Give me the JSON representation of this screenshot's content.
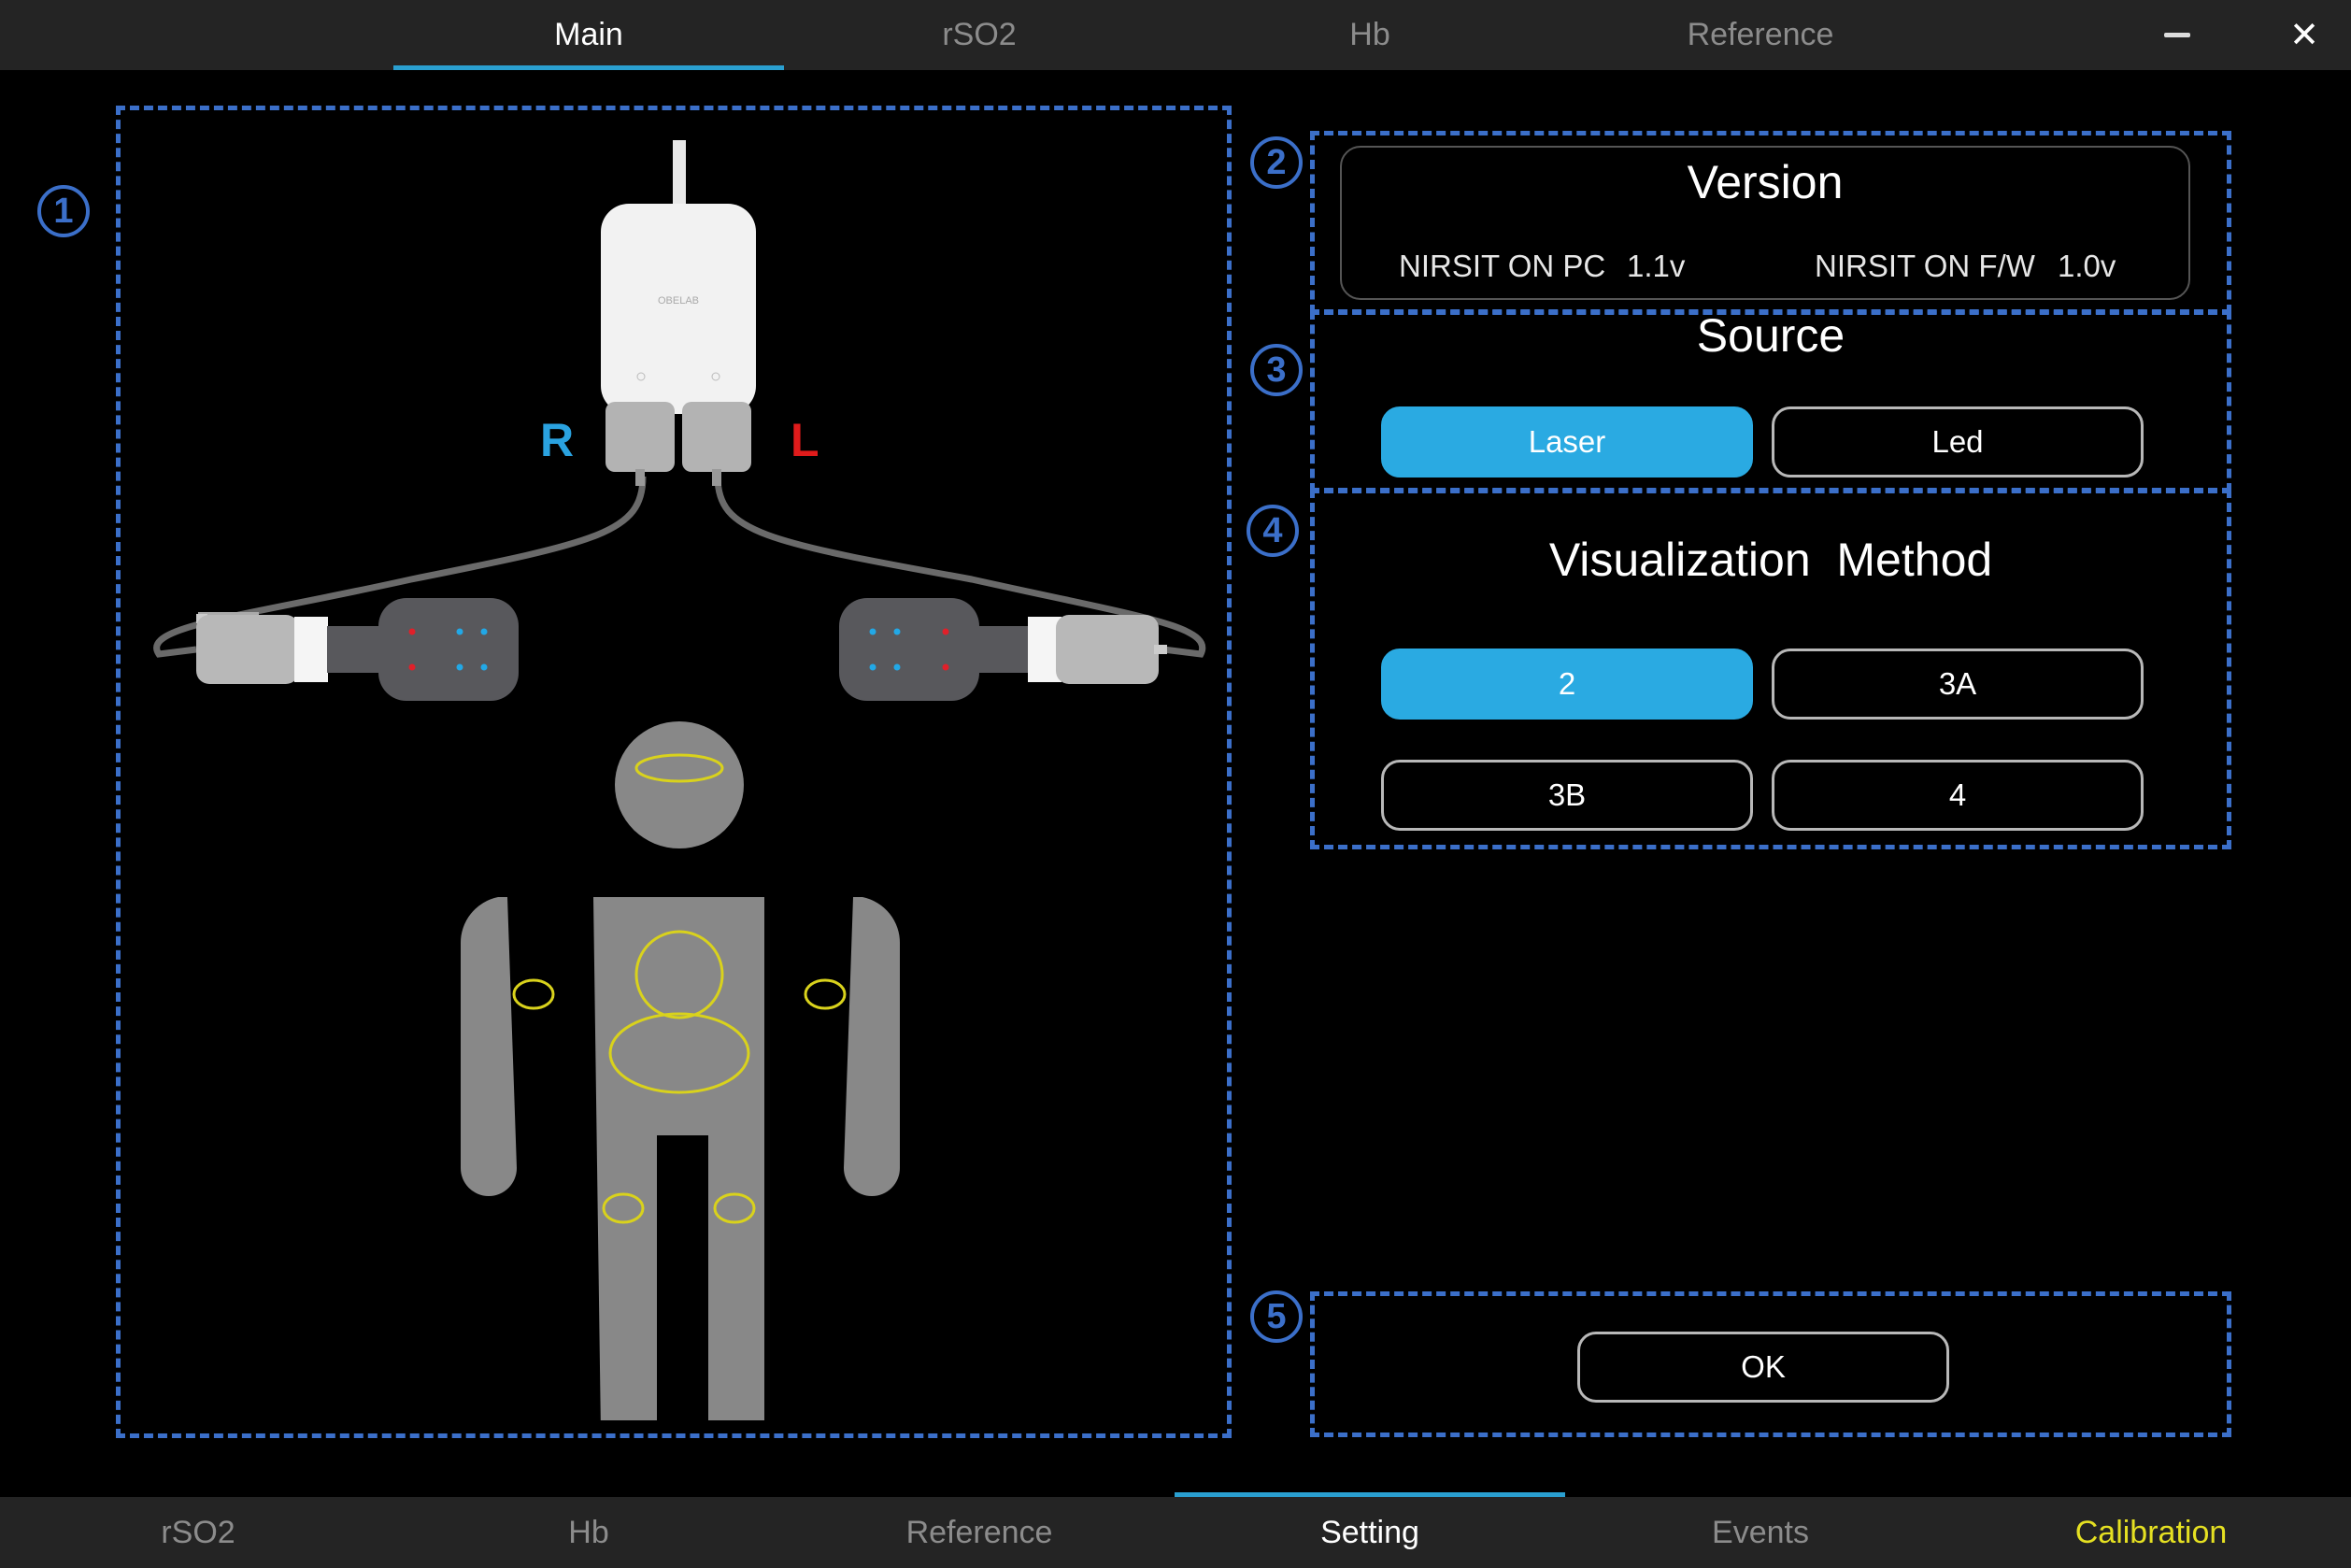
{
  "top_tabs": [
    {
      "label": "Main",
      "active": true
    },
    {
      "label": "rSO2",
      "active": false
    },
    {
      "label": "Hb",
      "active": false
    },
    {
      "label": "Reference",
      "active": false
    }
  ],
  "window_controls": {
    "minimize": "—",
    "close": "✕"
  },
  "annotations": [
    "1",
    "2",
    "3",
    "4",
    "5"
  ],
  "device": {
    "right_label": "R",
    "left_label": "L",
    "right_color": "#2aa2e0",
    "left_color": "#e01b1b",
    "brand_text": "OBELAB"
  },
  "version": {
    "title": "Version",
    "pc_label": "NIRSIT ON PC",
    "pc_value": "1.1v",
    "fw_label": "NIRSIT ON F/W",
    "fw_value": "1.0v"
  },
  "source": {
    "title": "Source",
    "options": [
      {
        "label": "Laser",
        "selected": true
      },
      {
        "label": "Led",
        "selected": false
      }
    ]
  },
  "visualization": {
    "title": "Visualization  Method",
    "options": [
      {
        "label": "2",
        "selected": true
      },
      {
        "label": "3A",
        "selected": false
      },
      {
        "label": "3B",
        "selected": false
      },
      {
        "label": "4",
        "selected": false
      }
    ]
  },
  "ok_label": "OK",
  "bottom_tabs": [
    {
      "label": "rSO2",
      "active": false
    },
    {
      "label": "Hb",
      "active": false
    },
    {
      "label": "Reference",
      "active": false
    },
    {
      "label": "Setting",
      "active": true
    },
    {
      "label": "Events",
      "active": false
    },
    {
      "label": "Calibration",
      "active": false
    }
  ],
  "colors": {
    "accent": "#2aaae2",
    "annotation": "#3b6fc9",
    "calibration": "#e5e022",
    "sensor_ring": "#d9d21c"
  }
}
